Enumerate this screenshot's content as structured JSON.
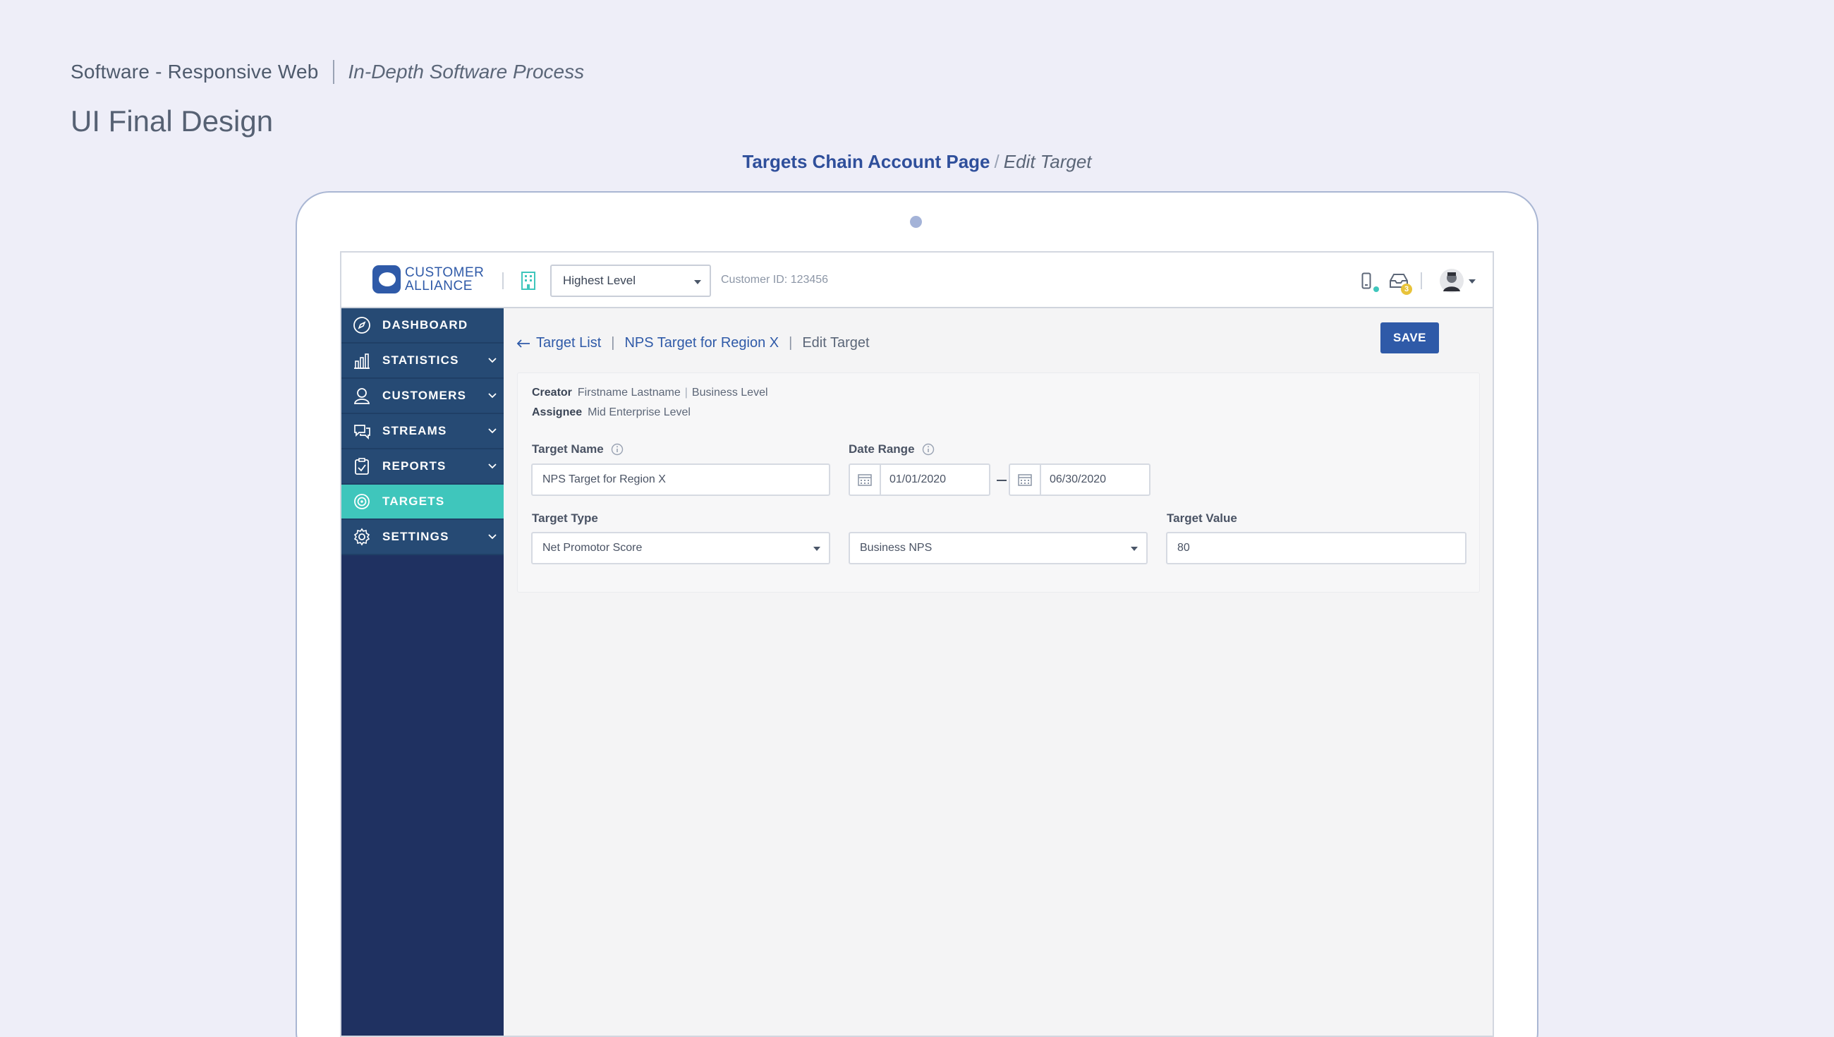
{
  "presentation": {
    "title": "Software - Responsive Web",
    "subtitle": "In-Depth Software Process",
    "heading": "UI Final Design",
    "page_name": "Targets Chain Account Page",
    "page_subname": "Edit Target"
  },
  "topbar": {
    "logo_line1": "CUSTOMER",
    "logo_line2": "ALLIANCE",
    "level_selected": "Highest Level",
    "customer_id": "Customer ID: 123456",
    "notification_count": "3",
    "icons": [
      "building-icon",
      "mobile-icon",
      "inbox-icon",
      "user-avatar",
      "chevron-down-icon"
    ]
  },
  "sidebar": {
    "items": [
      {
        "label": "DASHBOARD",
        "icon": "compass-icon",
        "expandable": false,
        "active": false
      },
      {
        "label": "STATISTICS",
        "icon": "bar-chart-icon",
        "expandable": true,
        "active": false
      },
      {
        "label": "CUSTOMERS",
        "icon": "user-icon",
        "expandable": true,
        "active": false
      },
      {
        "label": "STREAMS",
        "icon": "chat-bubbles-icon",
        "expandable": true,
        "active": false
      },
      {
        "label": "REPORTS",
        "icon": "clipboard-icon",
        "expandable": true,
        "active": false
      },
      {
        "label": "TARGETS",
        "icon": "target-icon",
        "expandable": false,
        "active": true
      },
      {
        "label": "SETTINGS",
        "icon": "gear-icon",
        "expandable": true,
        "active": false
      }
    ]
  },
  "breadcrumb": {
    "back": "Target List",
    "item": "NPS Target for Region X",
    "current": "Edit Target",
    "separator": "|"
  },
  "actions": {
    "save_label": "SAVE"
  },
  "form": {
    "creator_label": "Creator",
    "creator_name": "Firstname Lastname",
    "creator_level": "Business Level",
    "assignee_label": "Assignee",
    "assignee_value": "Mid Enterprise Level",
    "target_name_label": "Target Name",
    "target_name_value": "NPS Target for Region X",
    "date_range_label": "Date Range",
    "date_start": "01/01/2020",
    "date_end": "06/30/2020",
    "target_type_label": "Target Type",
    "target_type_value": "Net Promotor Score",
    "target_subtype_value": "Business NPS",
    "target_value_label": "Target Value",
    "target_value": "80"
  },
  "colors": {
    "accent": "#2f5aa8",
    "sidebar_bg": "#1f3161",
    "nav_item_bg": "#264a74",
    "active_item": "#3fc6bc",
    "notification_badge": "#e8c33a"
  }
}
